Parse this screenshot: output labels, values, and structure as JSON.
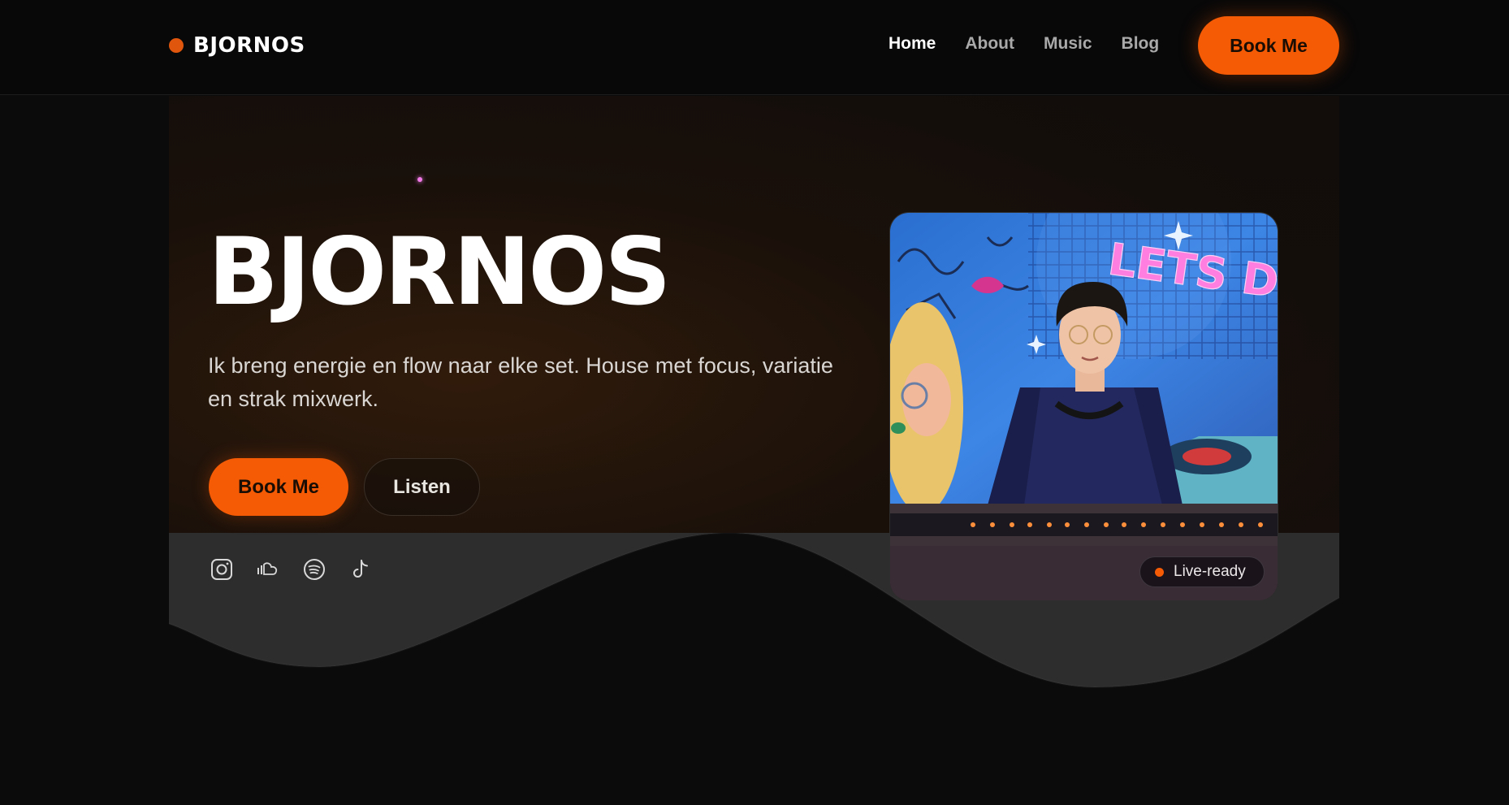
{
  "brand": {
    "name": "BJORNOS",
    "accent": "#f55a05"
  },
  "nav": {
    "links": [
      {
        "label": "Home",
        "active": true
      },
      {
        "label": "About",
        "active": false
      },
      {
        "label": "Music",
        "active": false
      },
      {
        "label": "Blog",
        "active": false
      }
    ],
    "cta": "Book Me"
  },
  "hero": {
    "title": "BJORNOS",
    "subtitle": "Ik breng energie en flow naar elke set. House met focus, variatie en strak mixwerk.",
    "primary_cta": "Book Me",
    "secondary_cta": "Listen",
    "socials": [
      "instagram-icon",
      "soundcloud-icon",
      "spotify-icon",
      "tiktok-icon"
    ],
    "photo_neon_text": "LETS D",
    "badge": "Live-ready"
  }
}
